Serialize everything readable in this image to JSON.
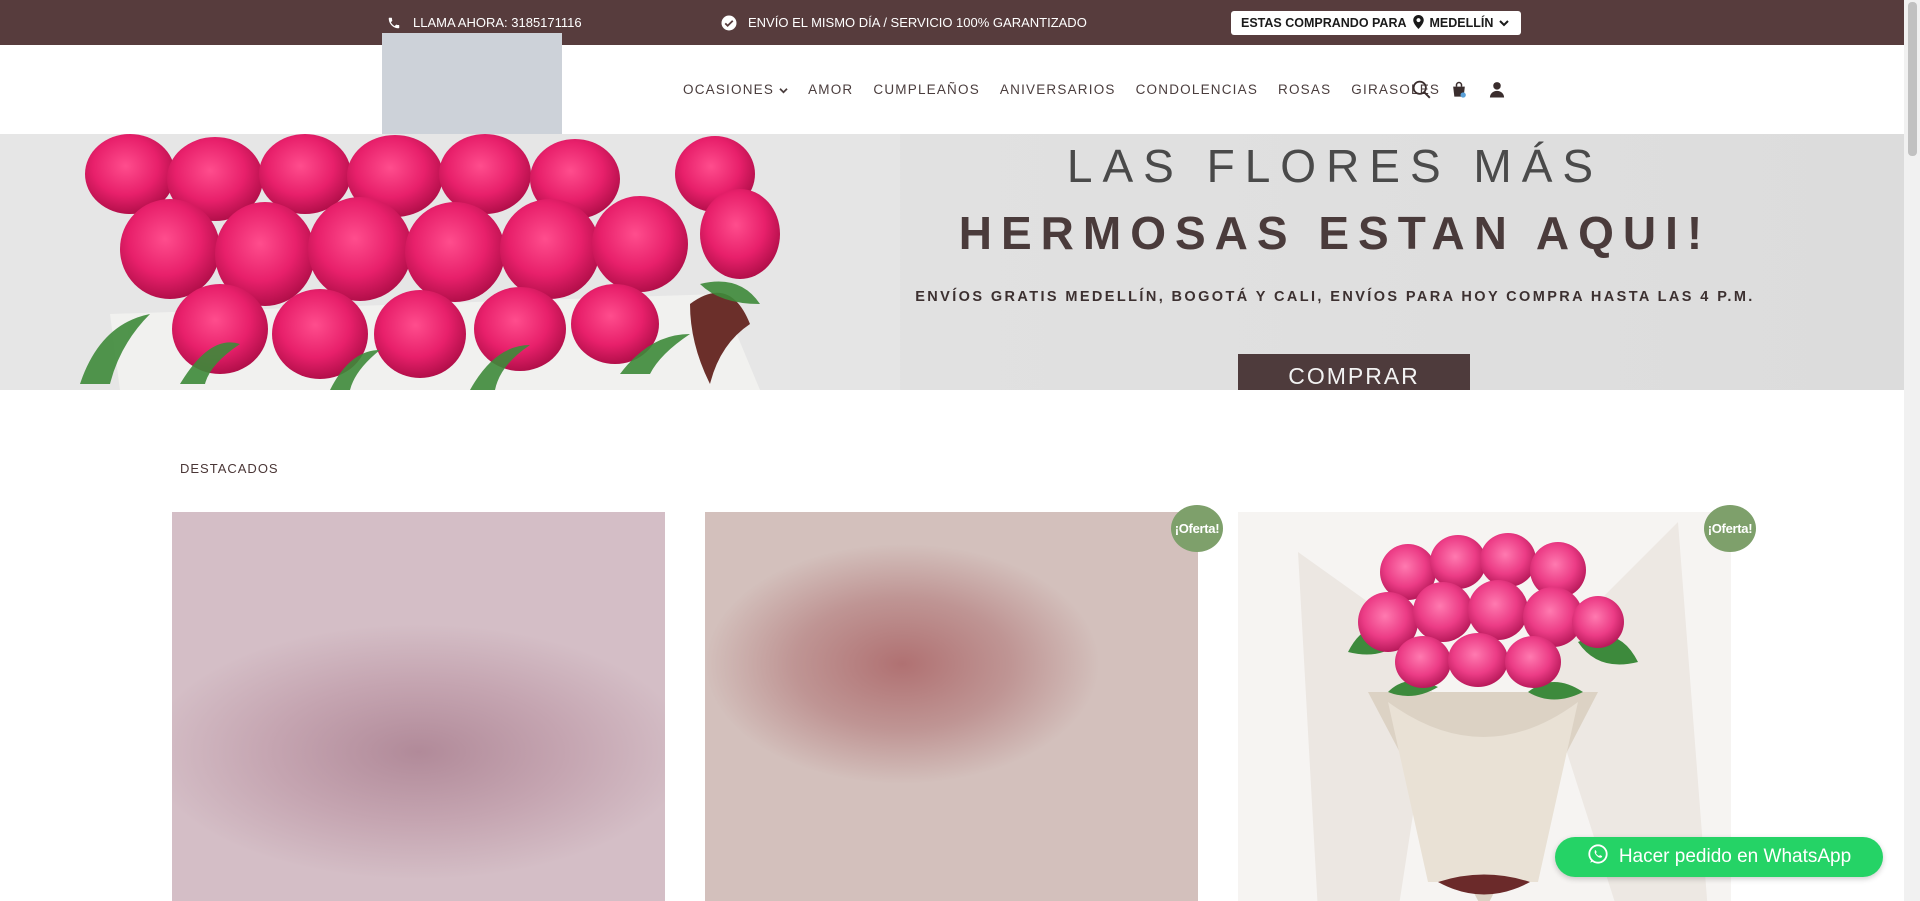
{
  "topbar": {
    "phone_text": "LLAMA AHORA: 3185171116",
    "shipping_text": "ENVÍO EL MISMO DÍA / SERVICIO 100% GARANTIZADO",
    "city_label": "ESTAS COMPRANDO PARA",
    "city_value": "MEDELLÍN"
  },
  "nav": {
    "items": [
      "OCASIONES",
      "AMOR",
      "CUMPLEAÑOS",
      "ANIVERSARIOS",
      "CONDOLENCIAS",
      "ROSAS",
      "GIRASOLES"
    ],
    "icons": [
      "search-icon",
      "cart-icon",
      "user-icon"
    ]
  },
  "hero": {
    "line1": "LAS FLORES MÁS",
    "line2": "HERMOSAS ESTAN AQUI!",
    "line3": "ENVÍOS GRATIS MEDELLÍN, BOGOTÁ Y CALI, ENVÍOS PARA HOY COMPRA HASTA LAS 4 P.M.",
    "button": "COMPRAR"
  },
  "featured": {
    "title": "DESTACADOS",
    "badge": "¡Oferta!"
  },
  "whatsapp": {
    "label": "Hacer pedido en WhatsApp"
  },
  "colors": {
    "topbar_bg": "#573c3d",
    "accent_dark": "#4e3b3c",
    "badge_green": "#7ea06b",
    "whatsapp_green": "#25d366"
  }
}
